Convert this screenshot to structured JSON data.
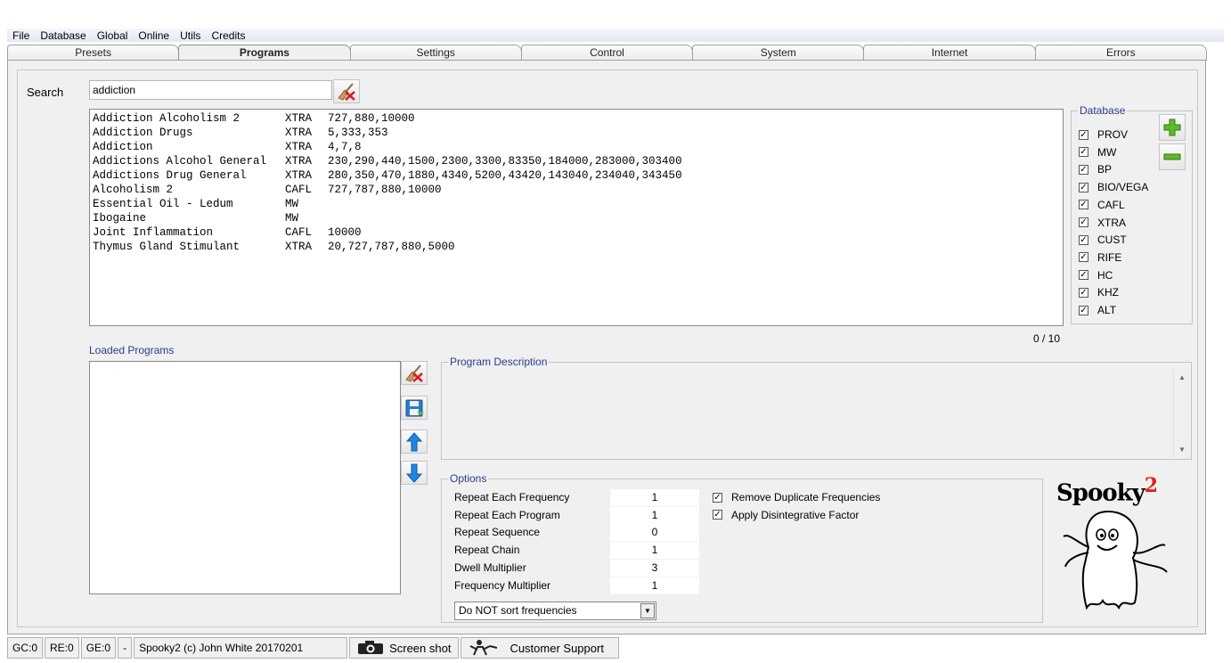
{
  "menu": [
    "File",
    "Database",
    "Global",
    "Online",
    "Utils",
    "Credits"
  ],
  "tabs": [
    "Presets",
    "Programs",
    "Settings",
    "Control",
    "System",
    "Internet",
    "Errors"
  ],
  "active_tab": "Programs",
  "search": {
    "label": "Search",
    "value": "addiction"
  },
  "results": [
    {
      "name": "Addiction Alcoholism 2",
      "db": "XTRA",
      "freqs": "727,880,10000"
    },
    {
      "name": "Addiction Drugs",
      "db": "XTRA",
      "freqs": "5,333,353"
    },
    {
      "name": "Addiction",
      "db": "XTRA",
      "freqs": "4,7,8"
    },
    {
      "name": "Addictions Alcohol General",
      "db": "XTRA",
      "freqs": "230,290,440,1500,2300,3300,83350,184000,283000,303400"
    },
    {
      "name": "Addictions Drug General",
      "db": "XTRA",
      "freqs": "280,350,470,1880,4340,5200,43420,143040,234040,343450"
    },
    {
      "name": "Alcoholism 2",
      "db": "CAFL",
      "freqs": "727,787,880,10000"
    },
    {
      "name": "Essential Oil - Ledum",
      "db": "MW",
      "freqs": ""
    },
    {
      "name": "Ibogaine",
      "db": "MW",
      "freqs": ""
    },
    {
      "name": "Joint Inflammation",
      "db": "CAFL",
      "freqs": "10000"
    },
    {
      "name": "Thymus Gland Stimulant",
      "db": "XTRA",
      "freqs": "20,727,787,880,5000"
    }
  ],
  "database": {
    "title": "Database",
    "items": [
      "PROV",
      "MW",
      "BP",
      "BIO/VEGA",
      "CAFL",
      "XTRA",
      "CUST",
      "RIFE",
      "HC",
      "KHZ",
      "ALT"
    ]
  },
  "count": "0 / 10",
  "loaded_programs_label": "Loaded Programs",
  "description": {
    "title": "Program Description"
  },
  "options": {
    "title": "Options",
    "rows": [
      {
        "label": "Repeat Each Frequency",
        "value": "1"
      },
      {
        "label": "Repeat Each Program",
        "value": "1"
      },
      {
        "label": "Repeat Sequence",
        "value": "0"
      },
      {
        "label": "Repeat Chain",
        "value": "1"
      },
      {
        "label": "Dwell Multiplier",
        "value": "3"
      },
      {
        "label": "Frequency Multiplier",
        "value": "1"
      }
    ],
    "checks": [
      "Remove Duplicate Frequencies",
      "Apply Disintegrative Factor"
    ],
    "sort_selected": "Do NOT sort frequencies"
  },
  "logo": {
    "text": "Spooky",
    "superscript": "2",
    "accent": "#e0201c"
  },
  "status": {
    "gc": "GC:0",
    "re": "RE:0",
    "ge": "GE:0",
    "dash": "-",
    "copyright": "Spooky2 (c) John White 20170201",
    "screenshot": "Screen shot",
    "support": "Customer Support"
  }
}
